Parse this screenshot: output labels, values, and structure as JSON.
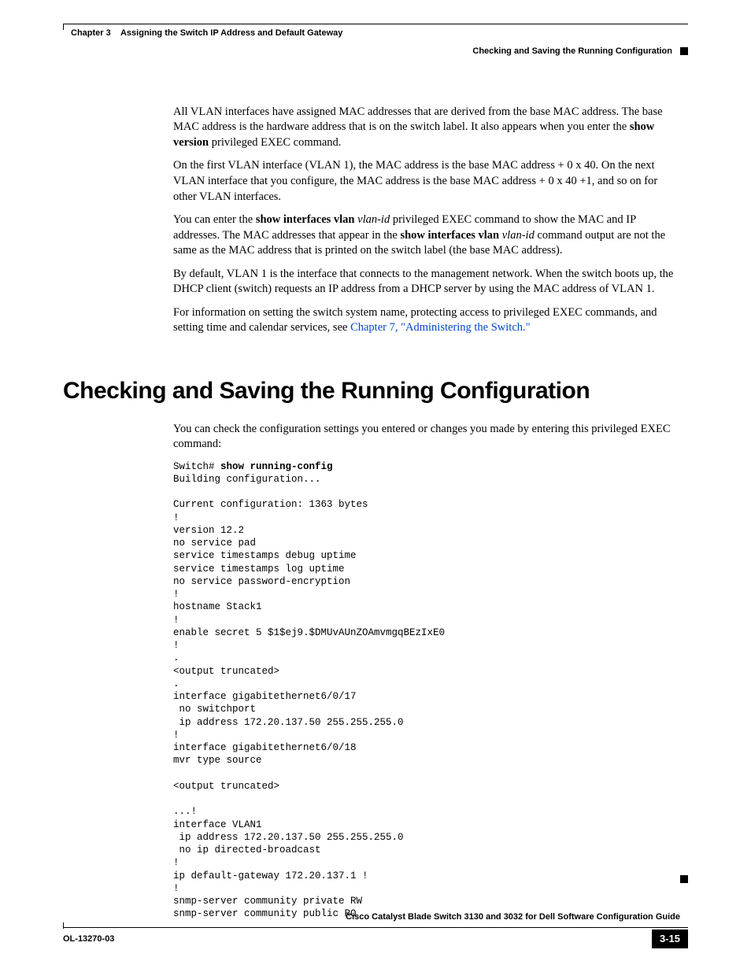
{
  "header": {
    "chapter_label": "Chapter 3",
    "chapter_title": "Assigning the Switch IP Address and Default Gateway",
    "section_title": "Checking and Saving the Running Configuration"
  },
  "paragraphs": {
    "p1_a": "All VLAN interfaces have assigned MAC addresses that are derived from the base MAC address. The base MAC address is the hardware address that is on the switch label. It also appears when you enter the ",
    "p1_b": "show version",
    "p1_c": " privileged EXEC command.",
    "p2": "On the first VLAN interface (VLAN 1), the MAC address is the base MAC address + 0 x 40. On the next VLAN interface that you configure, the MAC address is the base MAC address + 0 x 40 +1, and so on for other VLAN interfaces.",
    "p3_a": "You can enter the ",
    "p3_b": "show interfaces vlan",
    "p3_c": " vlan-id",
    "p3_d": " privileged EXEC command to show the MAC and IP addresses. The MAC addresses that appear in the ",
    "p3_e": "show interfaces vlan",
    "p3_f": " vlan-id",
    "p3_g": " command output are not the same as the MAC address that is printed on the switch label (the base MAC address).",
    "p4": "By default, VLAN 1 is the interface that connects to the management network. When the switch boots up, the DHCP client (switch) requests an IP address from a DHCP server by using the MAC address of VLAN 1.",
    "p5_a": "For information on setting the switch system name, protecting access to privileged EXEC commands, and setting time and calendar services, see ",
    "p5_link": "Chapter 7, \"Administering the Switch.\""
  },
  "h1": "Checking and Saving the Running Configuration",
  "intro": "You can check the configuration settings you entered or changes you made by entering this privileged EXEC command:",
  "code": {
    "line1_a": "Switch# ",
    "line1_b": "show running-config",
    "rest": "Building configuration...\n\nCurrent configuration: 1363 bytes\n!\nversion 12.2\nno service pad\nservice timestamps debug uptime\nservice timestamps log uptime\nno service password-encryption\n!\nhostname Stack1\n!\nenable secret 5 $1$ej9.$DMUvAUnZOAmvmgqBEzIxE0\n!\n.\n<output truncated>\n.\ninterface gigabitethernet6/0/17\n no switchport\n ip address 172.20.137.50 255.255.255.0 \n!\ninterface gigabitethernet6/0/18\nmvr type source\n\n<output truncated>\n\n...!\ninterface VLAN1\n ip address 172.20.137.50 255.255.255.0\n no ip directed-broadcast\n!\nip default-gateway 172.20.137.1 !\n!\nsnmp-server community private RW\nsnmp-server community public RO"
  },
  "footer": {
    "guide": "Cisco Catalyst Blade Switch 3130 and 3032 for Dell Software Configuration Guide",
    "doc_id": "OL-13270-03",
    "page_num": "3-15"
  }
}
